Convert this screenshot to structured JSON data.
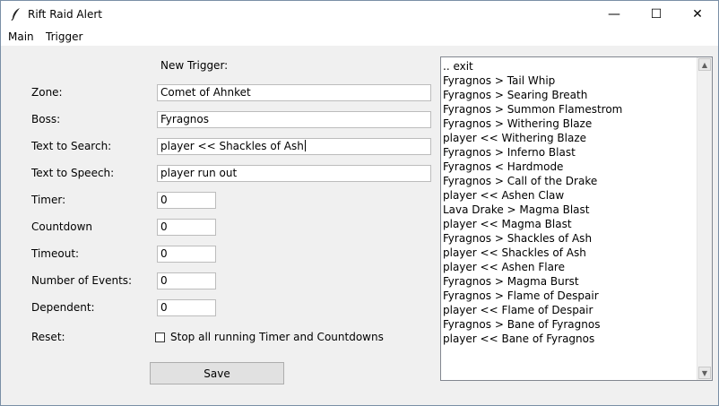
{
  "window": {
    "title": "Rift Raid Alert",
    "minimize_glyph": "—",
    "maximize_glyph": "☐",
    "close_glyph": "✕"
  },
  "menu": {
    "items": [
      "Main",
      "Trigger"
    ]
  },
  "form": {
    "heading": "New Trigger:",
    "zone": {
      "label": "Zone:",
      "value": "Comet of Ahnket"
    },
    "boss": {
      "label": "Boss:",
      "value": "Fyragnos"
    },
    "text_search": {
      "label": "Text to Search:",
      "value": "player << Shackles of Ash"
    },
    "text_speech": {
      "label": "Text to Speech:",
      "value": "player run out"
    },
    "timer": {
      "label": "Timer:",
      "value": "0"
    },
    "countdown": {
      "label": "Countdown",
      "value": "0"
    },
    "timeout": {
      "label": "Timeout:",
      "value": "0"
    },
    "num_events": {
      "label": "Number of Events:",
      "value": "0"
    },
    "dependent": {
      "label": "Dependent:",
      "value": "0"
    },
    "reset": {
      "label": "Reset:",
      "checkbox_label": "Stop all running Timer and Countdowns",
      "checked": false
    },
    "save_label": "Save"
  },
  "trigger_list": {
    "items": [
      ".. exit",
      "Fyragnos > Tail Whip",
      "Fyragnos > Searing Breath",
      "Fyragnos > Summon Flamestrom",
      "Fyragnos > Withering Blaze",
      "player << Withering Blaze",
      "Fyragnos > Inferno Blast",
      "Fyragnos < Hardmode",
      "Fyragnos > Call of the Drake",
      "player << Ashen Claw",
      "Lava Drake > Magma Blast",
      "player << Magma Blast",
      "Fyragnos > Shackles of Ash",
      "player << Shackles of Ash",
      "player << Ashen Flare",
      "Fyragnos > Magma Burst",
      "Fyragnos > Flame of Despair",
      "player << Flame of Despair",
      "Fyragnos > Bane of Fyragnos",
      "player << Bane of Fyragnos"
    ],
    "scroll_up_glyph": "▲",
    "scroll_down_glyph": "▼"
  }
}
